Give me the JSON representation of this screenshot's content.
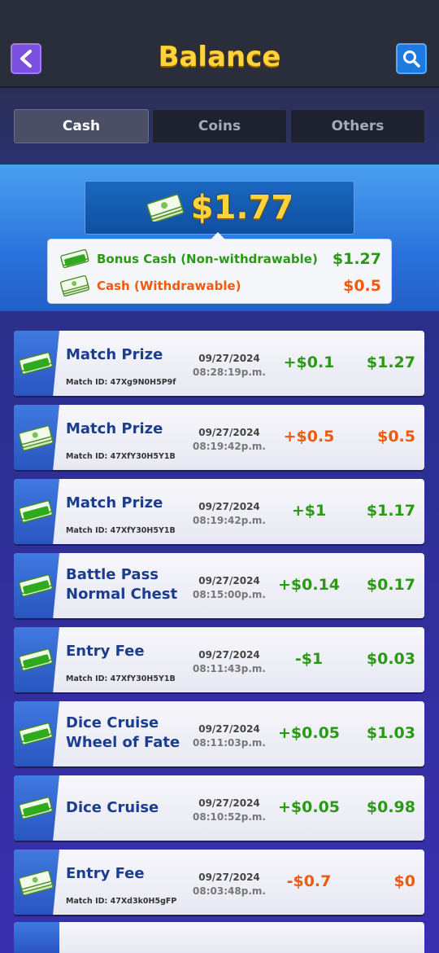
{
  "header": {
    "title": "Balance",
    "back_icon": "chevron-left-icon",
    "search_icon": "search-icon"
  },
  "tabs": [
    {
      "label": "Cash",
      "active": true
    },
    {
      "label": "Coins",
      "active": false
    },
    {
      "label": "Others",
      "active": false
    }
  ],
  "summary": {
    "total": "$1.77",
    "bonus_label": "Bonus Cash (Non-withdrawable)",
    "bonus_value": "$1.27",
    "cash_label": "Cash (Withdrawable)",
    "cash_value": "$0.5"
  },
  "colors": {
    "positive": "#2a9a16",
    "withdrawable": "#ee5a12",
    "title": "#ffd43a",
    "name": "#1a3d8f"
  },
  "transactions": [
    {
      "name": "Match Prize",
      "match_id": "Match ID: 47Xg9N0H5P9f",
      "date": "09/27/2024",
      "time": "08:28:19p.m.",
      "change": "+$0.1",
      "balance": "$1.27",
      "kind": "bonus"
    },
    {
      "name": "Match Prize",
      "match_id": "Match ID: 47XfY30H5Y1B",
      "date": "09/27/2024",
      "time": "08:19:42p.m.",
      "change": "+$0.5",
      "balance": "$0.5",
      "kind": "cash"
    },
    {
      "name": "Match Prize",
      "match_id": "Match ID: 47XfY30H5Y1B",
      "date": "09/27/2024",
      "time": "08:19:42p.m.",
      "change": "+$1",
      "balance": "$1.17",
      "kind": "bonus"
    },
    {
      "name": "Battle Pass Normal Chest",
      "match_id": "",
      "date": "09/27/2024",
      "time": "08:15:00p.m.",
      "change": "+$0.14",
      "balance": "$0.17",
      "kind": "bonus"
    },
    {
      "name": "Entry Fee",
      "match_id": "Match ID: 47XfY30H5Y1B",
      "date": "09/27/2024",
      "time": "08:11:43p.m.",
      "change": "-$1",
      "balance": "$0.03",
      "kind": "bonus"
    },
    {
      "name": "Dice Cruise Wheel of Fate",
      "match_id": "",
      "date": "09/27/2024",
      "time": "08:11:03p.m.",
      "change": "+$0.05",
      "balance": "$1.03",
      "kind": "bonus"
    },
    {
      "name": "Dice Cruise",
      "match_id": "",
      "date": "09/27/2024",
      "time": "08:10:52p.m.",
      "change": "+$0.05",
      "balance": "$0.98",
      "kind": "bonus"
    },
    {
      "name": "Entry Fee",
      "match_id": "Match ID: 47Xd3k0H5gFP",
      "date": "09/27/2024",
      "time": "08:03:48p.m.",
      "change": "-$0.7",
      "balance": "$0",
      "kind": "cash"
    }
  ]
}
